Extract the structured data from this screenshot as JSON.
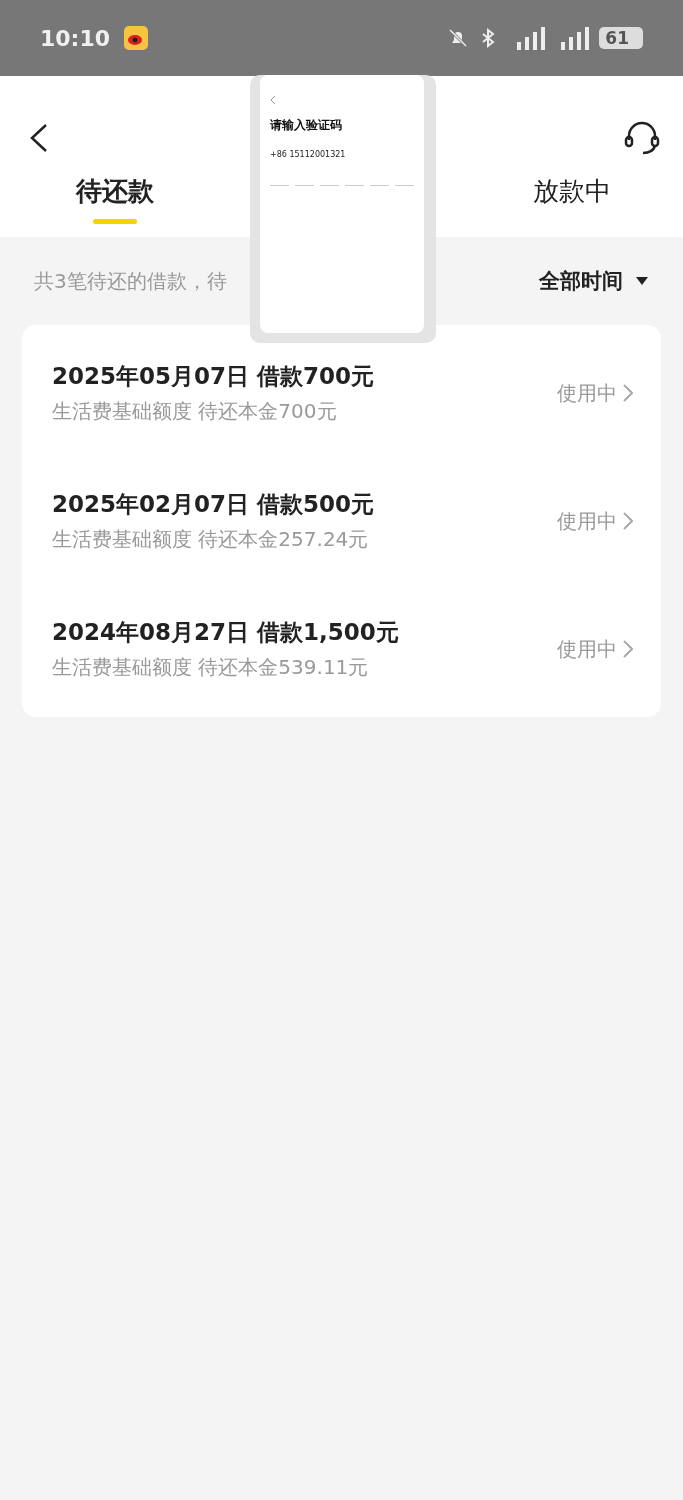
{
  "status_bar": {
    "time": "10:10",
    "battery": "61"
  },
  "tabs": [
    {
      "label": "待还款",
      "selected": true
    },
    {
      "label": "放款中",
      "selected": false
    }
  ],
  "summary": "共3笔待还的借款，待",
  "filter": {
    "label": "全部时间"
  },
  "loans": [
    {
      "title": "2025年05月07日 借款700元",
      "detail": "生活费基础额度 待还本金700元",
      "status": "使用中"
    },
    {
      "title": "2025年02月07日 借款500元",
      "detail": "生活费基础额度 待还本金257.24元",
      "status": "使用中"
    },
    {
      "title": "2024年08月27日 借款1,500元",
      "detail": "生活费基础额度 待还本金539.11元",
      "status": "使用中"
    }
  ],
  "preview": {
    "title": "请输入验证码",
    "phone": "+86 15112001321"
  }
}
